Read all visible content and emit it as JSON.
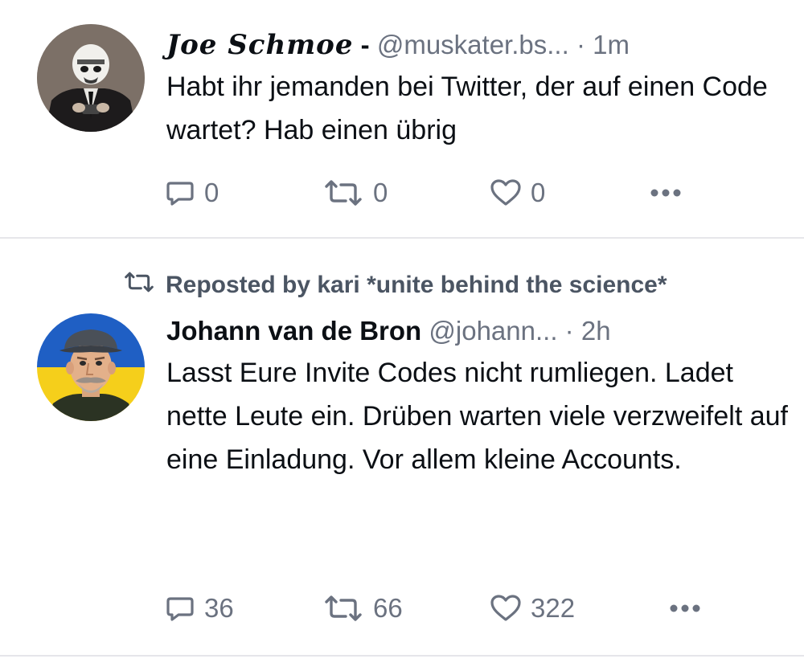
{
  "posts": [
    {
      "author_name": "Joe Schmoe",
      "name_separator": "-",
      "handle": "@muskater.bs...",
      "separator": "·",
      "time": "1m",
      "text": "Habt ihr jemanden bei Twitter, der auf einen Code wartet? Hab einen übrig",
      "reply_count": "0",
      "repost_count": "0",
      "like_count": "0",
      "avatar": "stormtrooper-helmet-suit-photo"
    },
    {
      "repost_label": "Reposted by kari *unite behind the science*",
      "author_name": "Johann van de Bron",
      "handle": "@johann...",
      "separator": "·",
      "time": "2h",
      "text": "Lasst Eure Invite Codes nicht rumliegen. Ladet nette Leute ein. Drüben warten viele verzweifelt auf eine Einladung. Vor allem kleine Accounts.",
      "reply_count": "36",
      "repost_count": "66",
      "like_count": "322",
      "avatar": "man-with-cap-on-ukraine-flag"
    }
  ],
  "icons": {
    "reply": "speech-bubble-icon",
    "repost": "repost-arrows-icon",
    "like": "heart-icon",
    "more": "ellipsis-icon"
  },
  "colors": {
    "text": "#0b0f14",
    "muted": "#6b7280",
    "divider": "#e6e6ea",
    "flag_blue": "#1f5fc4",
    "flag_yellow": "#f5cf1b"
  }
}
